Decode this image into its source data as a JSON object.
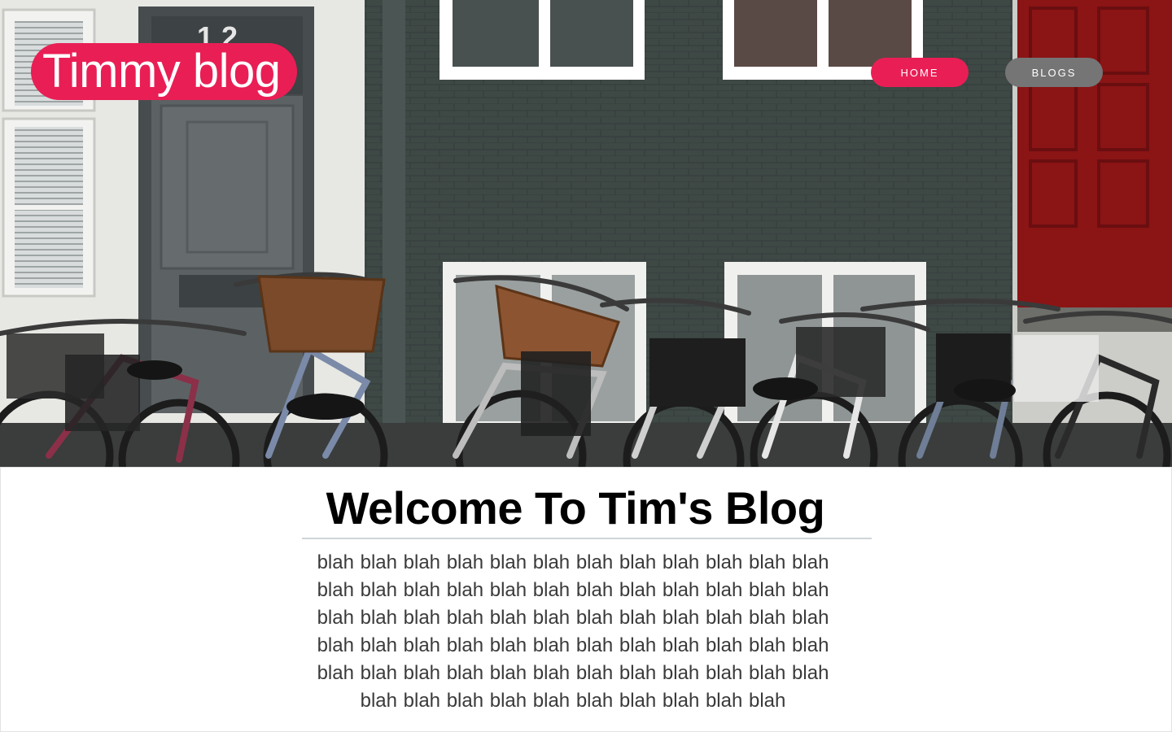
{
  "header": {
    "logo_text": "Timmy blog",
    "nav": {
      "home_label": "HOME",
      "blogs_label": "BLOGS"
    }
  },
  "hero": {
    "door_number": "12"
  },
  "main": {
    "title": "Welcome To Tim's Blog",
    "body": "blah blah blah blah blah blah blah blah blah blah blah blah blah blah blah blah blah blah blah blah blah blah blah blah blah blah blah blah blah blah blah blah blah blah blah blah blah blah blah blah blah blah blah blah blah blah blah blah blah blah blah blah blah blah blah blah blah blah blah blah blah blah blah blah blah blah blah blah blah blah"
  },
  "colors": {
    "accent": "#e91e55",
    "secondary_button": "#757575"
  }
}
